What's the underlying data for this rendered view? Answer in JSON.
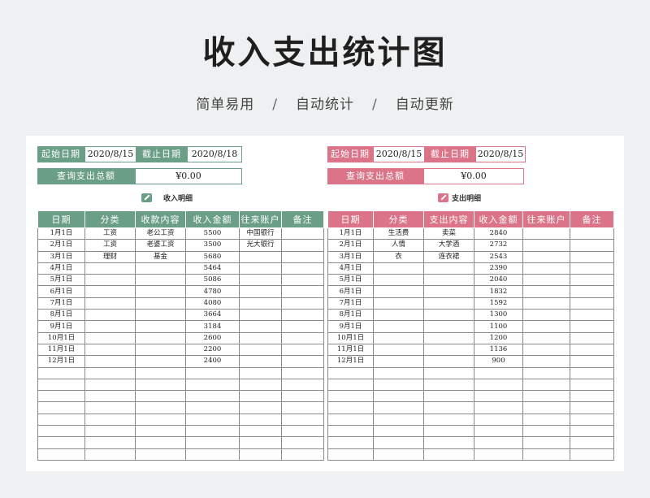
{
  "page": {
    "title": "收入支出统计图",
    "subtitle": [
      "简单易用",
      "自动统计",
      "自动更新"
    ],
    "subtitle_separator": "/"
  },
  "income": {
    "start_label": "起始日期",
    "start_value": "2020/8/15",
    "end_label": "截止日期",
    "end_value": "2020/8/18",
    "query_label": "查询支出总额",
    "query_value": "¥0.00",
    "section_title": "收入明细",
    "headers": [
      "日期",
      "分类",
      "收款内容",
      "收入金额",
      "往来账户",
      "备注"
    ],
    "rows": [
      [
        "1月1日",
        "工资",
        "老公工资",
        "5500",
        "中国银行",
        ""
      ],
      [
        "2月1日",
        "工资",
        "老婆工资",
        "3500",
        "光大银行",
        ""
      ],
      [
        "3月1日",
        "理财",
        "基金",
        "5680",
        "",
        ""
      ],
      [
        "4月1日",
        "",
        "",
        "5464",
        "",
        ""
      ],
      [
        "5月1日",
        "",
        "",
        "5086",
        "",
        ""
      ],
      [
        "6月1日",
        "",
        "",
        "4780",
        "",
        ""
      ],
      [
        "7月1日",
        "",
        "",
        "4080",
        "",
        ""
      ],
      [
        "8月1日",
        "",
        "",
        "3664",
        "",
        ""
      ],
      [
        "9月1日",
        "",
        "",
        "3184",
        "",
        ""
      ],
      [
        "10月1日",
        "",
        "",
        "2600",
        "",
        ""
      ],
      [
        "11月1日",
        "",
        "",
        "2200",
        "",
        ""
      ],
      [
        "12月1日",
        "",
        "",
        "2400",
        "",
        ""
      ],
      [
        "",
        "",
        "",
        "",
        "",
        ""
      ],
      [
        "",
        "",
        "",
        "",
        "",
        ""
      ],
      [
        "",
        "",
        "",
        "",
        "",
        ""
      ],
      [
        "",
        "",
        "",
        "",
        "",
        ""
      ],
      [
        "",
        "",
        "",
        "",
        "",
        ""
      ],
      [
        "",
        "",
        "",
        "",
        "",
        ""
      ],
      [
        "",
        "",
        "",
        "",
        "",
        ""
      ],
      [
        "",
        "",
        "",
        "",
        "",
        ""
      ]
    ]
  },
  "expense": {
    "start_label": "起始日期",
    "start_value": "2020/8/15",
    "end_label": "截止日期",
    "end_value": "2020/8/15",
    "query_label": "查询支出总额",
    "query_value": "¥0.00",
    "section_title": "支出明细",
    "headers": [
      "日期",
      "分类",
      "支出内容",
      "收入金额",
      "往来账户",
      "备注"
    ],
    "rows": [
      [
        "1月1日",
        "生活费",
        "卖菜",
        "2840",
        "",
        ""
      ],
      [
        "2月1日",
        "人情",
        "大学酒",
        "2732",
        "",
        ""
      ],
      [
        "3月1日",
        "衣",
        "连衣裙",
        "2543",
        "",
        ""
      ],
      [
        "4月1日",
        "",
        "",
        "2390",
        "",
        ""
      ],
      [
        "5月1日",
        "",
        "",
        "2040",
        "",
        ""
      ],
      [
        "6月1日",
        "",
        "",
        "1832",
        "",
        ""
      ],
      [
        "7月1日",
        "",
        "",
        "1592",
        "",
        ""
      ],
      [
        "8月1日",
        "",
        "",
        "1300",
        "",
        ""
      ],
      [
        "9月1日",
        "",
        "",
        "1100",
        "",
        ""
      ],
      [
        "10月1日",
        "",
        "",
        "1200",
        "",
        ""
      ],
      [
        "11月1日",
        "",
        "",
        "1136",
        "",
        ""
      ],
      [
        "12月1日",
        "",
        "",
        "900",
        "",
        ""
      ],
      [
        "",
        "",
        "",
        "",
        "",
        ""
      ],
      [
        "",
        "",
        "",
        "",
        "",
        ""
      ],
      [
        "",
        "",
        "",
        "",
        "",
        ""
      ],
      [
        "",
        "",
        "",
        "",
        "",
        ""
      ],
      [
        "",
        "",
        "",
        "",
        "",
        ""
      ],
      [
        "",
        "",
        "",
        "",
        "",
        ""
      ],
      [
        "",
        "",
        "",
        "",
        "",
        ""
      ],
      [
        "",
        "",
        "",
        "",
        "",
        ""
      ]
    ]
  },
  "colors": {
    "income_accent": "#6b9e87",
    "expense_accent": "#db7488"
  },
  "icons": {
    "section_icon": "edit-icon"
  }
}
